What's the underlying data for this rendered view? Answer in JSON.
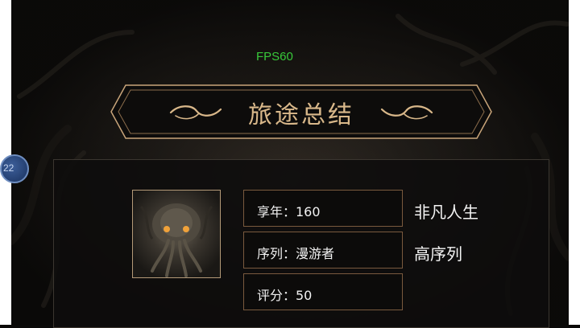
{
  "hud": {
    "fps": "FPS60"
  },
  "banner": {
    "title": "旅途总结"
  },
  "side_bubble": {
    "text": "22"
  },
  "summary": {
    "portrait_icon": "eldritch-creature-portrait",
    "stats": [
      {
        "label": "享年：160"
      },
      {
        "label": "序列：漫游者"
      },
      {
        "label": "评分：50"
      }
    ],
    "tags": [
      {
        "text": "非凡人生"
      },
      {
        "text": "高序列"
      }
    ]
  },
  "colors": {
    "accent": "#d9b88a",
    "fps": "#38c93a",
    "box_border": "#7a5a3e"
  }
}
